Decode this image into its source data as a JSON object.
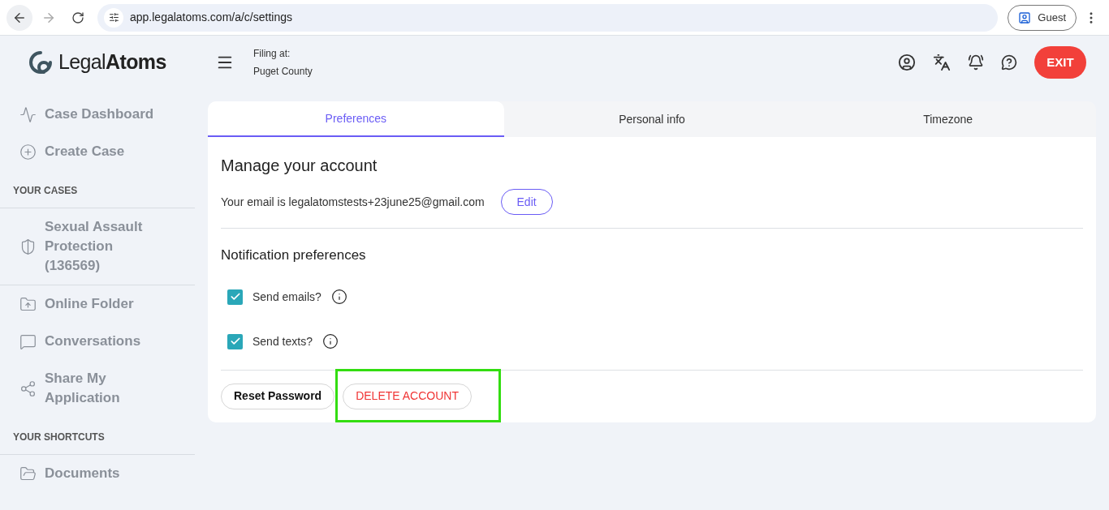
{
  "browser": {
    "url": "app.legalatoms.com/a/c/settings",
    "profile": "Guest"
  },
  "header": {
    "logo": "Legal**Atoms**",
    "filing_label": "Filing at:",
    "filing_value": "Puget County",
    "exit": "EXIT"
  },
  "sidebar": {
    "sections": [
      {
        "items": [
          {
            "kind": "dashboard",
            "label": "Case Dashboard"
          },
          {
            "kind": "create",
            "label": "Create Case"
          }
        ]
      },
      {
        "heading": "YOUR CASES",
        "items": [
          {
            "kind": "case",
            "label": "Sexual Assault Protection (136569)"
          }
        ]
      },
      {
        "items": [
          {
            "kind": "folder",
            "label": "Online Folder"
          },
          {
            "kind": "chat",
            "label": "Conversations"
          },
          {
            "kind": "share",
            "label": "Share My Application"
          }
        ]
      },
      {
        "heading": "YOUR SHORTCUTS",
        "items": [
          {
            "kind": "documents",
            "label": "Documents"
          }
        ]
      }
    ]
  },
  "tabs": [
    {
      "label": "Preferences",
      "selected": true
    },
    {
      "label": "Personal info",
      "selected": false
    },
    {
      "label": "Timezone",
      "selected": false
    }
  ],
  "account": {
    "title": "Manage your account",
    "email_text": "Your email is legalatomstests+23june25@gmail.com",
    "edit": "Edit"
  },
  "notifications": {
    "title": "Notification preferences",
    "options": [
      {
        "label": "Send emails?",
        "checked": true
      },
      {
        "label": "Send texts?",
        "checked": true
      }
    ]
  },
  "actions": [
    {
      "kind": "neutral",
      "label": "Reset Password",
      "highlighted": false
    },
    {
      "kind": "danger",
      "label": "DELETE ACCOUNT",
      "highlighted": true
    }
  ]
}
